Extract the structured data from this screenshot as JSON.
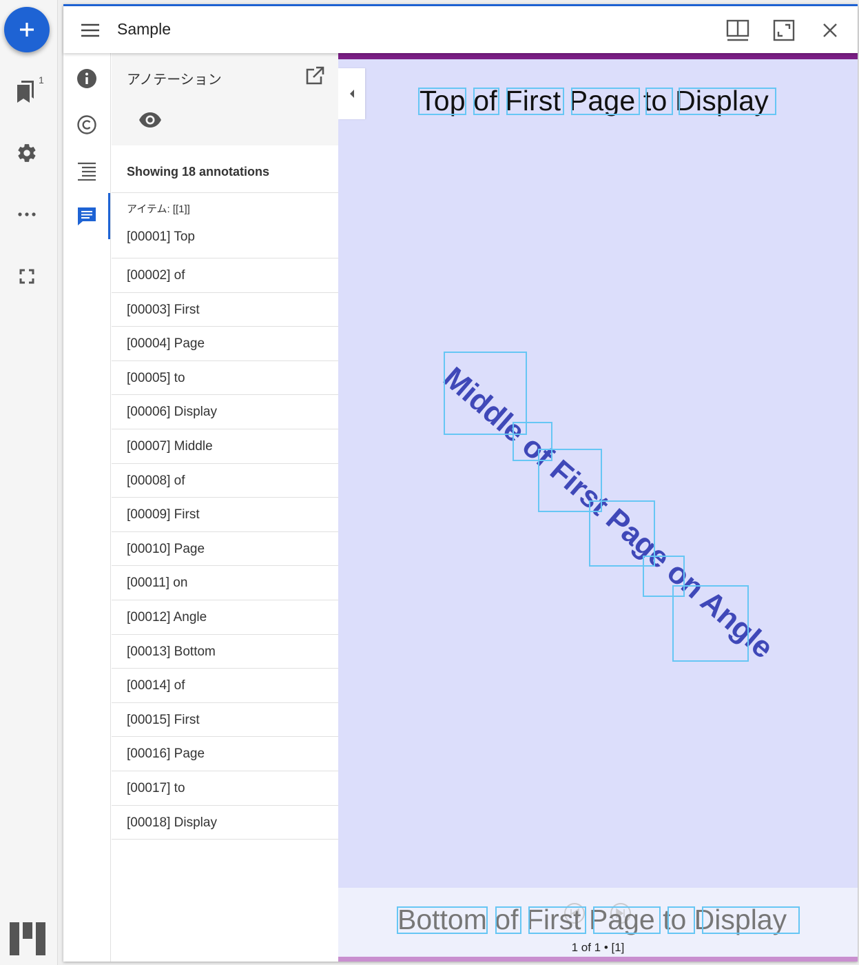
{
  "rail": {
    "bookmark_badge": "1"
  },
  "window": {
    "title": "Sample"
  },
  "panel": {
    "title": "アノテーション",
    "count_text": "Showing 18 annotations",
    "item_label": "アイテム: [[1]]",
    "annotations": [
      "[00001] Top",
      "[00002] of",
      "[00003] First",
      "[00004] Page",
      "[00005] to",
      "[00006] Display",
      "[00007] Middle",
      "[00008] of",
      "[00009] First",
      "[00010] Page",
      "[00011] on",
      "[00012] Angle",
      "[00013] Bottom",
      "[00014] of",
      "[00015] First",
      "[00016] Page",
      "[00017] to",
      "[00018] Display"
    ]
  },
  "canvas": {
    "top_text": "Top of First Page to Display",
    "middle_text": "Middle of First Page on Angle",
    "bottom_text": "Bottom of First Page to Display",
    "pager": "1 of 1 • [1]"
  },
  "colors": {
    "accent": "#1e63d4",
    "canvas_bg": "#dcdefb",
    "ocr_box": "#66c6f4",
    "angled_text": "#3f48b8"
  }
}
